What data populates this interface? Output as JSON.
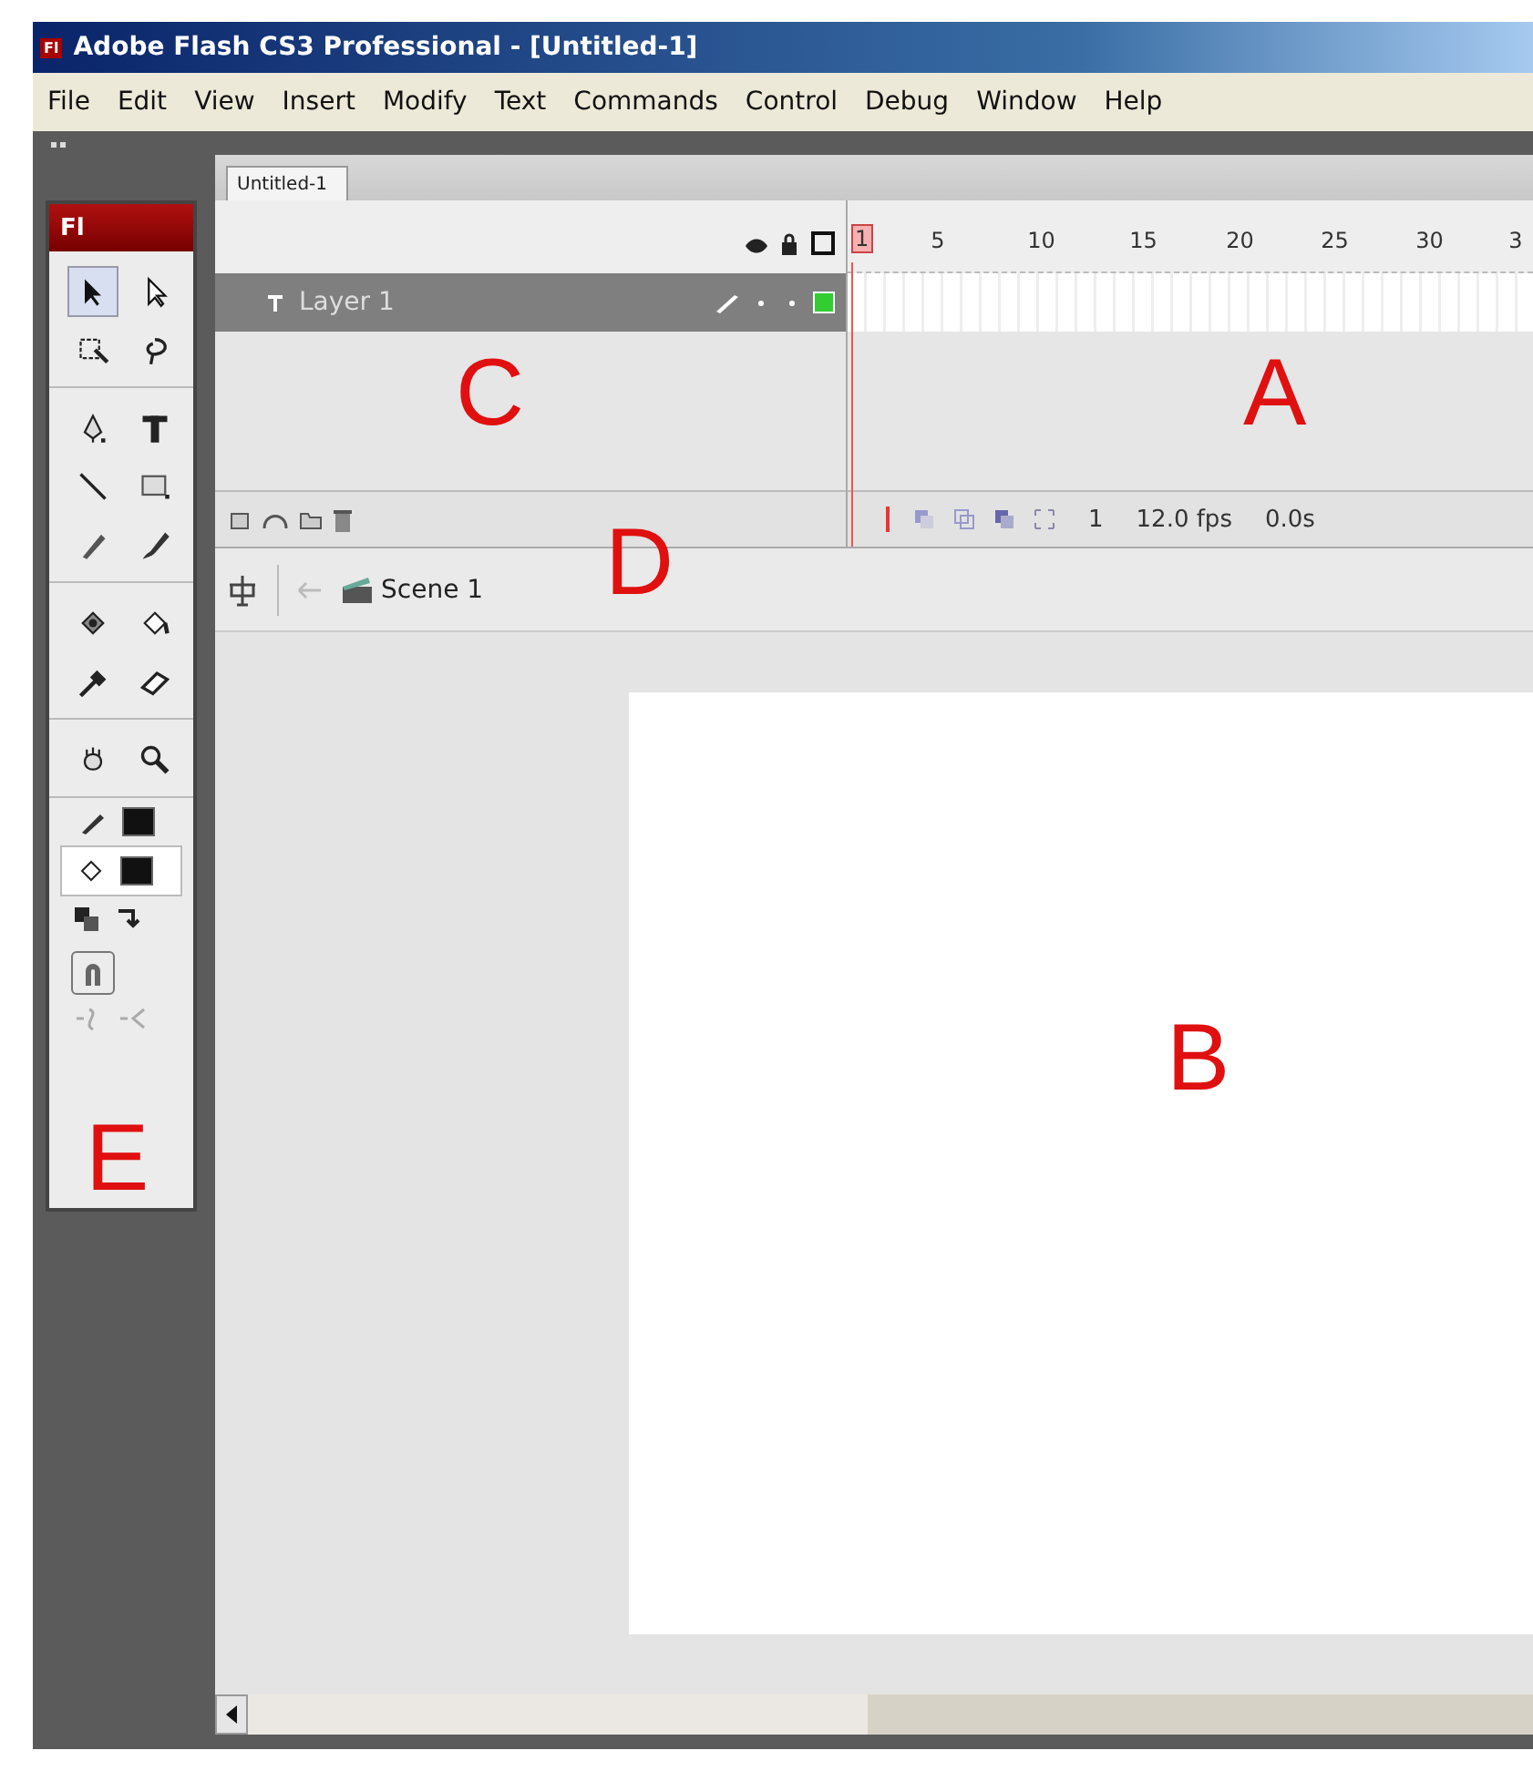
{
  "window": {
    "title": "Adobe Flash CS3 Professional - [Untitled-1]",
    "logo": "Fl"
  },
  "menu": [
    "File",
    "Edit",
    "View",
    "Insert",
    "Modify",
    "Text",
    "Commands",
    "Control",
    "Debug",
    "Window",
    "Help"
  ],
  "toolbox": {
    "logo": "Fl",
    "tools": [
      {
        "selected": true
      },
      {
        "selected": false
      },
      {
        "selected": false
      },
      {
        "selected": false
      },
      {
        "selected": false
      },
      {
        "selected": false
      },
      {
        "selected": false
      },
      {
        "selected": false
      },
      {
        "selected": false
      },
      {
        "selected": false
      },
      {
        "selected": false
      },
      {
        "selected": false
      },
      {
        "selected": false
      },
      {
        "selected": false
      },
      {
        "selected": false
      },
      {
        "selected": false
      }
    ],
    "options": [
      {
        "disabled": true
      },
      {
        "disabled": true
      }
    ]
  },
  "document_tabs": [
    {
      "label": "Untitled-1",
      "selected": true
    }
  ],
  "timeline": {
    "frame_numbers": [
      "1",
      "5",
      "10",
      "15",
      "20",
      "25",
      "30",
      "3"
    ],
    "layers": [
      {
        "name": "Layer 1",
        "selected": true
      }
    ],
    "current_frame": "1",
    "frame_rate": "12.0 fps",
    "elapsed_time": "0.0s"
  },
  "edit_bar": {
    "scene": "Scene 1"
  },
  "annotations": [
    "C",
    "A",
    "D",
    "B",
    "E"
  ]
}
